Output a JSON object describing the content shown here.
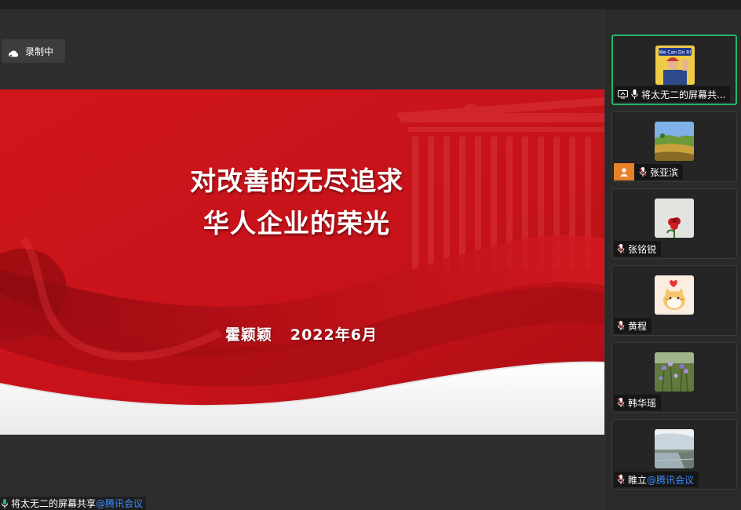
{
  "window": {
    "title": ""
  },
  "recording": {
    "label": "录制中",
    "icon": "cloud-icon"
  },
  "slide": {
    "title_line1": "对改善的无尽追求",
    "title_line2": "华人企业的荣光",
    "author_date": "霍颖颖   2022年6月",
    "colors": {
      "primary_red": "#c8141b",
      "dark_red": "#9d0d12"
    }
  },
  "share_label": {
    "text": "将太无二的屏幕共享",
    "brand": "@腾讯会议"
  },
  "participants": [
    {
      "name": "将太无二的屏幕共...",
      "brand": "",
      "active": true,
      "sharing": true,
      "mic": "on",
      "avatar": "rosie-poster",
      "avatar_text": "We Can Do It!"
    },
    {
      "name": "张亚滨",
      "brand": "",
      "active": false,
      "sharing": false,
      "mic": "muted",
      "avatar": "landscape",
      "host_badge": true
    },
    {
      "name": "张铭锐",
      "brand": "",
      "active": false,
      "sharing": false,
      "mic": "muted",
      "avatar": "red-flower"
    },
    {
      "name": "黄程",
      "brand": "",
      "active": false,
      "sharing": false,
      "mic": "muted",
      "avatar": "cartoon-cat"
    },
    {
      "name": "韩华瑶",
      "brand": "",
      "active": false,
      "sharing": false,
      "mic": "muted",
      "avatar": "purple-flowers"
    },
    {
      "name": "睢立",
      "brand": "@腾讯会议",
      "active": false,
      "sharing": false,
      "mic": "muted",
      "avatar": "lake-sky"
    }
  ],
  "accent": {
    "active_border": "#27b56a",
    "link": "#3b8cff",
    "host_badge": "#e8822a"
  }
}
